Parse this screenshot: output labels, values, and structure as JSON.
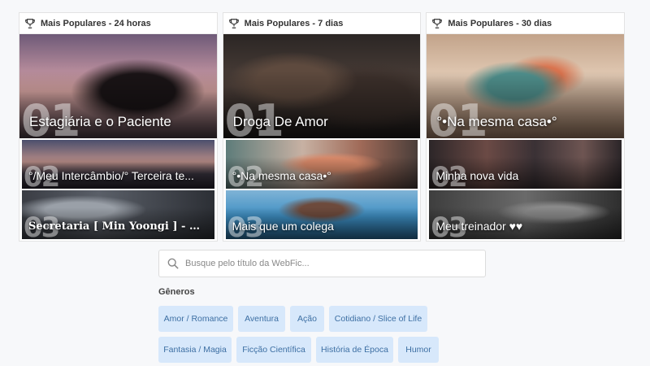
{
  "columns": [
    {
      "header": "Mais Populares - 24 horas",
      "cards": [
        {
          "rank": "01",
          "title": "Estagiária e o Paciente"
        },
        {
          "rank": "02",
          "title": "°/Meu Intercâmbio/° Terceira te..."
        },
        {
          "rank": "03",
          "title": "Secretaria [ Min Yoongi ] - BTS"
        }
      ]
    },
    {
      "header": "Mais Populares - 7 dias",
      "cards": [
        {
          "rank": "01",
          "title": "Droga De Amor"
        },
        {
          "rank": "02",
          "title": "°•Na mesma casa•°"
        },
        {
          "rank": "03",
          "title": "Mais que um colega"
        }
      ]
    },
    {
      "header": "Mais Populares - 30 dias",
      "cards": [
        {
          "rank": "01",
          "title": "°•Na mesma casa•°"
        },
        {
          "rank": "02",
          "title": "Minha nova vida"
        },
        {
          "rank": "03",
          "title": "Meu treinador ♥♥"
        }
      ]
    }
  ],
  "search": {
    "placeholder": "Busque pelo título da WebFic..."
  },
  "genres": {
    "title": "Gêneros",
    "items": [
      "Amor / Romance",
      "Aventura",
      "Ação",
      "Cotidiano / Slice of Life",
      "Fantasia / Magia",
      "Ficção Científica",
      "História de Época",
      "Humor"
    ]
  },
  "colors": {
    "chip_bg": "#d7e8fb",
    "chip_text": "#3d6fa3"
  },
  "icons": {
    "header": "trophy-icon",
    "search": "search-icon"
  }
}
